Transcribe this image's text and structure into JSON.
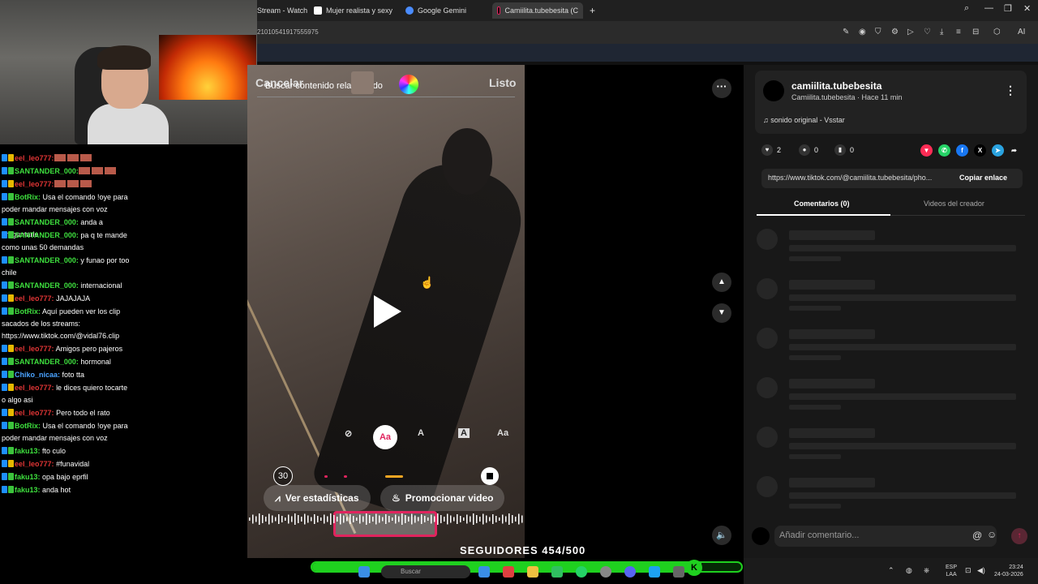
{
  "browser": {
    "tabs": [
      {
        "label": "Stream - Watch"
      },
      {
        "label": "Mujer realista y sexy"
      },
      {
        "label": "Google Gemini"
      },
      {
        "label": "Camiilita.tubebesita (C"
      }
    ],
    "new_tab": "+",
    "address": "21010541917555975",
    "ai_label": "AI"
  },
  "chat": {
    "messages": [
      {
        "user": "eel_leo777:",
        "text": "",
        "style": "red"
      },
      {
        "user": "SANTANDER_000:",
        "text": "",
        "style": "green"
      },
      {
        "user": "eel_leo777:",
        "text": "",
        "style": "red"
      },
      {
        "user": "BotRix:",
        "text": "Usa el comando !oye para poder mandar mensajes con voz",
        "style": "green"
      },
      {
        "user": "SANTANDER_000:",
        "text": "anda a preguntarle",
        "style": "green"
      },
      {
        "user": "SANTANDER_000:",
        "text": "pa q te mande como unas 50 demandas",
        "style": "green"
      },
      {
        "user": "SANTANDER_000:",
        "text": "y funao por too chile",
        "style": "green"
      },
      {
        "user": "SANTANDER_000:",
        "text": "internacional",
        "style": "green"
      },
      {
        "user": "eel_leo777:",
        "text": "JAJAJAJA",
        "style": "red"
      },
      {
        "user": "BotRix:",
        "text": "Aquí pueden ver los clip sacados de los streams: https://www.tiktok.com/@vidal76.clip",
        "style": "green"
      },
      {
        "user": "eel_leo777:",
        "text": "Amigos pero pajeros",
        "style": "red"
      },
      {
        "user": "SANTANDER_000:",
        "text": "hormonal",
        "style": "green"
      },
      {
        "user": "Chiko_nicaa:",
        "text": "foto tta",
        "style": "blue"
      },
      {
        "user": "eel_leo777:",
        "text": "le dices quiero tocarte o algo asi",
        "style": "red"
      },
      {
        "user": "eel_leo777:",
        "text": "Pero todo el rato",
        "style": "red"
      },
      {
        "user": "BotRix:",
        "text": "Usa el comando !oye para poder mandar mensajes con voz",
        "style": "green"
      },
      {
        "user": "faku13:",
        "text": "fto culo",
        "style": "green"
      },
      {
        "user": "eel_leo777:",
        "text": "#funavidal",
        "style": "red"
      },
      {
        "user": "faku13:",
        "text": "opa bajo eprfil",
        "style": "green"
      },
      {
        "user": "faku13:",
        "text": "anda hot",
        "style": "green"
      }
    ]
  },
  "video": {
    "cancel": "Cancelar",
    "search_placeholder": "Buscar contenido relacionado",
    "done": "Listo",
    "text_tools": [
      "Aa",
      "A",
      "A",
      "Aa"
    ],
    "timer": "30",
    "stats_button": "Ver estadísticas",
    "promote_button": "Promocionar video",
    "followers_label": "SEGUIDORES 454/500",
    "followers_progress": 0.908
  },
  "panel": {
    "username": "camiilita.tubebesita",
    "meta": "Camiilita.tubebesita · Hace 11 min",
    "music": "sonido original - Vsstar",
    "likes": "2",
    "comments": "0",
    "saves": "0",
    "link_url": "https://www.tiktok.com/@camiilita.tubebesita/pho...",
    "copy_link": "Copiar enlace",
    "tab_comments": "Comentarios (0)",
    "tab_creator": "Videos del creador",
    "comment_placeholder": "Añadir comentario..."
  },
  "taskbar": {
    "search_label": "Buscar",
    "lang_top": "ESP",
    "lang_bottom": "LAA",
    "time": "23:24",
    "date": "24-03-2026"
  },
  "colors": {
    "accent": "#e0245e",
    "follow_bar": "#1fd01f",
    "chat_green": "#3ee03e",
    "chat_red": "#e03535"
  }
}
